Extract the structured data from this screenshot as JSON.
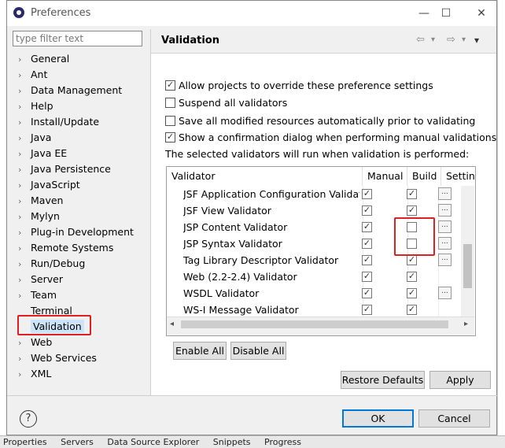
{
  "window": {
    "title": "Preferences",
    "minimize_glyph": "—",
    "maximize_glyph": "☐",
    "close_glyph": "✕"
  },
  "filter": {
    "placeholder": "type filter text"
  },
  "tree": {
    "items": [
      {
        "label": "General",
        "expandable": true
      },
      {
        "label": "Ant",
        "expandable": true
      },
      {
        "label": "Data Management",
        "expandable": true
      },
      {
        "label": "Help",
        "expandable": true
      },
      {
        "label": "Install/Update",
        "expandable": true
      },
      {
        "label": "Java",
        "expandable": true
      },
      {
        "label": "Java EE",
        "expandable": true
      },
      {
        "label": "Java Persistence",
        "expandable": true
      },
      {
        "label": "JavaScript",
        "expandable": true
      },
      {
        "label": "Maven",
        "expandable": true
      },
      {
        "label": "Mylyn",
        "expandable": true
      },
      {
        "label": "Plug-in Development",
        "expandable": true
      },
      {
        "label": "Remote Systems",
        "expandable": true
      },
      {
        "label": "Run/Debug",
        "expandable": true
      },
      {
        "label": "Server",
        "expandable": true
      },
      {
        "label": "Team",
        "expandable": true
      },
      {
        "label": "Terminal",
        "expandable": false
      },
      {
        "label": "Validation",
        "expandable": false,
        "selected": true
      },
      {
        "label": "Web",
        "expandable": true
      },
      {
        "label": "Web Services",
        "expandable": true
      },
      {
        "label": "XML",
        "expandable": true
      }
    ]
  },
  "page": {
    "title": "Validation",
    "nav_back": "⇦",
    "nav_forward": "⇨",
    "dropdown": "▾",
    "menu": "▾",
    "options": [
      {
        "label": "Allow projects to override these preference settings",
        "checked": true
      },
      {
        "label": "Suspend all validators",
        "checked": false
      },
      {
        "label": "Save all modified resources automatically prior to validating",
        "checked": false
      },
      {
        "label": "Show a confirmation dialog when performing manual validations",
        "checked": true
      }
    ],
    "description": "The selected validators will run when validation is performed:"
  },
  "table": {
    "headers": [
      "Validator",
      "Manual",
      "Build",
      "Settings"
    ],
    "rows": [
      {
        "name": "JSF Application Configuration Validator",
        "manual": true,
        "build": true,
        "settings": true
      },
      {
        "name": "JSF View Validator",
        "manual": true,
        "build": true,
        "settings": true
      },
      {
        "name": "JSP Content Validator",
        "manual": true,
        "build": false,
        "settings": true
      },
      {
        "name": "JSP Syntax Validator",
        "manual": true,
        "build": false,
        "settings": true
      },
      {
        "name": "Tag Library Descriptor Validator",
        "manual": true,
        "build": true,
        "settings": true
      },
      {
        "name": "Web (2.2-2.4) Validator",
        "manual": true,
        "build": true,
        "settings": false
      },
      {
        "name": "WSDL Validator",
        "manual": true,
        "build": true,
        "settings": true
      },
      {
        "name": "WS-I Message Validator",
        "manual": true,
        "build": true,
        "settings": false
      }
    ],
    "settings_glyph": "...",
    "scroll_left": "◂",
    "scroll_right": "▸"
  },
  "buttons": {
    "enable_all": "Enable All",
    "disable_all": "Disable All",
    "restore_defaults": "Restore Defaults",
    "apply": "Apply",
    "ok": "OK",
    "cancel": "Cancel",
    "help": "?"
  },
  "ide_bottom_tabs": [
    "Properties",
    "Servers",
    "Data Source Explorer",
    "Snippets",
    "Progress"
  ],
  "colors": {
    "highlight": "#e02020",
    "selection": "#cce4f7",
    "ok_border": "#0078d7"
  }
}
